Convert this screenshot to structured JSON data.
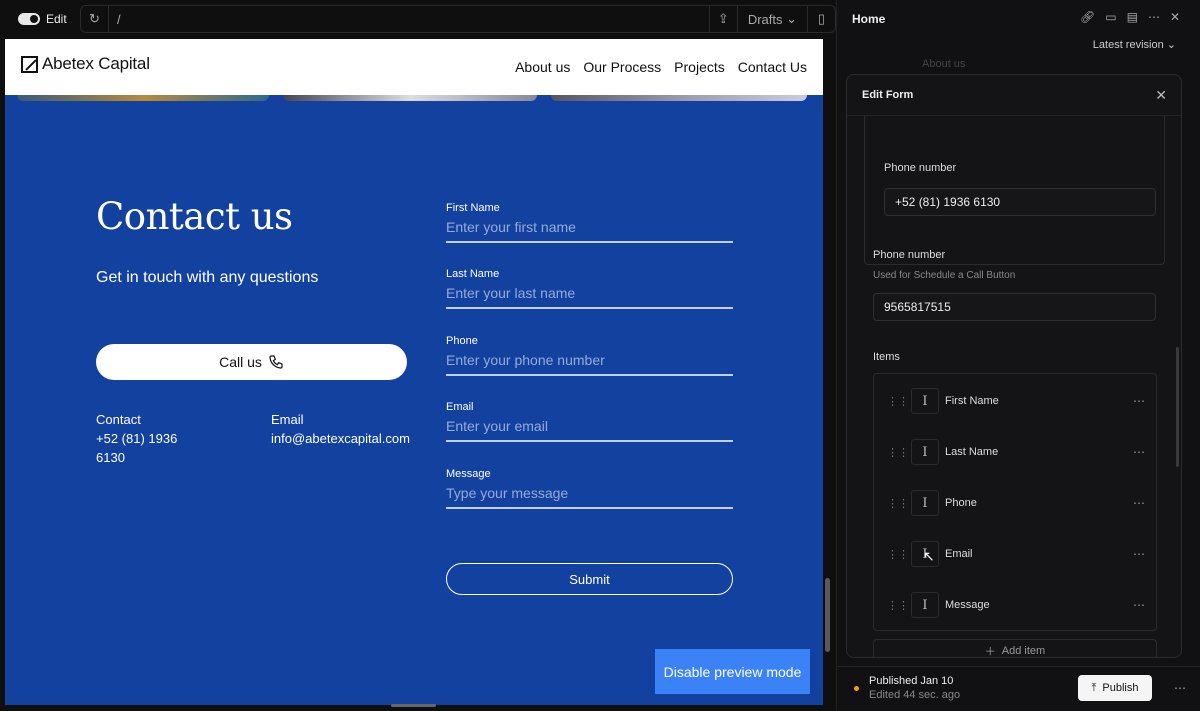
{
  "toolbar": {
    "mode_label": "Edit",
    "url_path": "/",
    "drafts_label": "Drafts"
  },
  "site": {
    "logo_text": "Abetex Capital",
    "nav": [
      "About us",
      "Our Process",
      "Projects",
      "Contact Us"
    ],
    "contact_title": "Contact us",
    "contact_subtitle": "Get in touch with any questions",
    "call_button": "Call us",
    "contact_label": "Contact",
    "contact_phone_1": "+52 (81) 1936",
    "contact_phone_2": "6130",
    "email_label": "Email",
    "email_value": "info@abetexcapital.com",
    "form": [
      {
        "label": "First Name",
        "placeholder": "Enter your first name"
      },
      {
        "label": "Last Name",
        "placeholder": "Enter your last name"
      },
      {
        "label": "Phone",
        "placeholder": "Enter your phone number"
      },
      {
        "label": "Email",
        "placeholder": "Enter your email"
      },
      {
        "label": "Message",
        "placeholder": "Type your message"
      }
    ],
    "submit": "Submit",
    "disable_preview": "Disable preview mode",
    "brand_color": "#1341a0",
    "button_color": "#3b82f6"
  },
  "panel": {
    "page_title": "Home",
    "revision": "Latest revision",
    "ghost_item": "About us",
    "modal_title": "Edit Form",
    "phone_label_1": "Phone number",
    "phone_value_1": "+52 (81) 1936 6130",
    "phone_label_2": "Phone number",
    "phone_desc_2": "Used for Schedule a Call Button",
    "phone_value_2": "9565817515",
    "items_label": "Items",
    "items": [
      "First Name",
      "Last Name",
      "Phone",
      "Email",
      "Message"
    ],
    "add_item": "Add item",
    "published": "Published Jan 10",
    "edited": "Edited 44 sec. ago",
    "publish_button": "Publish"
  }
}
